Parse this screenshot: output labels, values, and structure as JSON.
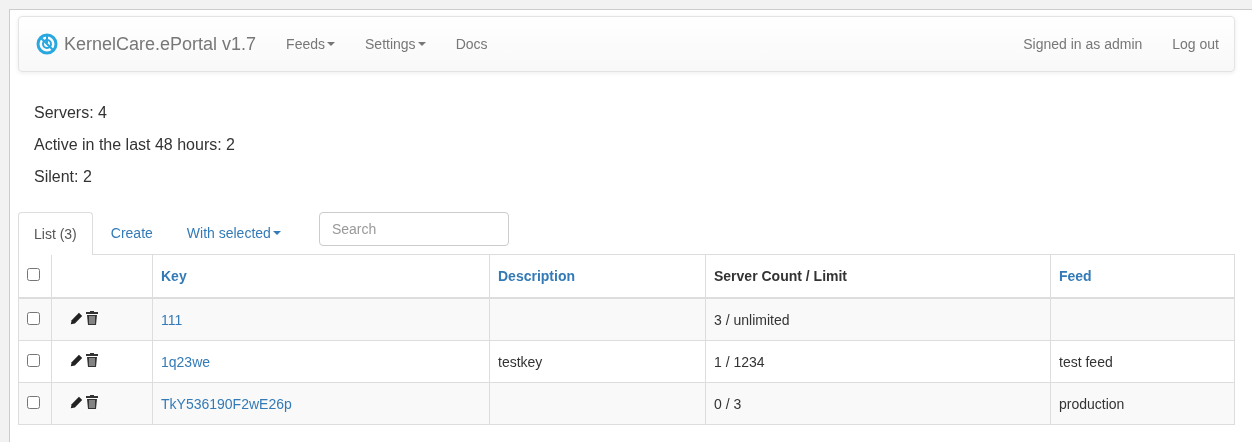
{
  "navbar": {
    "brand": "KernelCare.ePortal v1.7",
    "menu": [
      {
        "label": "Feeds",
        "dropdown": true
      },
      {
        "label": "Settings",
        "dropdown": true
      },
      {
        "label": "Docs",
        "dropdown": false
      }
    ],
    "user": "Signed in as admin",
    "logout": "Log out"
  },
  "stats": [
    "Servers: 4",
    "Active in the last 48 hours: 2",
    "Silent: 2"
  ],
  "tabs": [
    {
      "label": "List (3)",
      "selected": true,
      "dropdown": false
    },
    {
      "label": "Create",
      "selected": false,
      "dropdown": false
    },
    {
      "label": "With selected",
      "selected": false,
      "dropdown": true
    }
  ],
  "search": {
    "placeholder": "Search"
  },
  "table": {
    "select_all": {
      "checked": false
    },
    "columns": [
      {
        "label": "Key",
        "sortable": true
      },
      {
        "label": "Description",
        "sortable": true
      },
      {
        "label": "Server Count / Limit",
        "sortable": false
      },
      {
        "label": "Feed",
        "sortable": true
      }
    ],
    "rows": [
      {
        "checked": false,
        "key": "111",
        "count": "3 / unlimited"
      },
      {
        "checked": false,
        "key": "1q23we",
        "description": "testkey",
        "count": "1 / 1234",
        "feed": "test feed"
      },
      {
        "checked": false,
        "key": "TkY536190F2wE26p",
        "count": "0 / 3",
        "feed": "production"
      }
    ]
  }
}
